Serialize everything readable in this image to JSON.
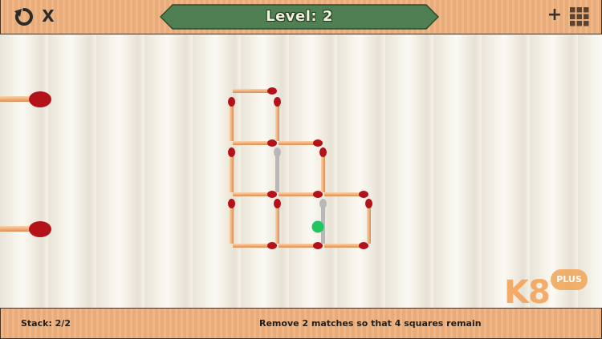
{
  "header": {
    "level_text": "Level: 2",
    "close_label": "X",
    "add_label": "+",
    "icons": [
      "undo-icon",
      "grid-menu-icon"
    ]
  },
  "footer": {
    "stack_text": "Stack: 2/2",
    "instruction_text": "Remove 2 matches so that 4 squares remain"
  },
  "watermark": {
    "brand": "K8",
    "badge": "PLUS"
  },
  "colors": {
    "wood": "#f0b27e",
    "banner": "#4f7f52",
    "match_head": "#b3121b",
    "match_stick": "#f1b07a",
    "removed_slot": "#b8b8b8",
    "cursor_dot": "#22c55e"
  }
}
